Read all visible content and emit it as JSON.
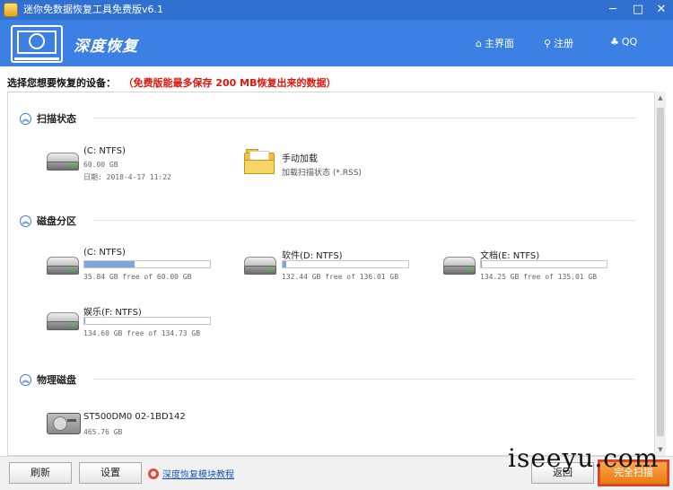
{
  "window": {
    "title": "迷你免数据恢复工具免费版v6.1",
    "min_label": "─",
    "max_label": "□",
    "close_label": "✕"
  },
  "header": {
    "brand": "深度恢复",
    "nav": [
      {
        "icon": "⌂",
        "label": "主界面"
      },
      {
        "icon": "⚲",
        "label": "注册"
      },
      {
        "icon": "♣",
        "label": "QQ"
      }
    ]
  },
  "prompt": {
    "label": "选择您想要恢复的设备：",
    "warning": "（免费版能最多保存 200 MB恢复出来的数据）"
  },
  "sections": {
    "scan_state": {
      "title": "扫描状态",
      "toggle": "︽",
      "items": [
        {
          "name": "(C: NTFS)",
          "size": "60.00 GB",
          "date": "日期: 2018-4-17 11:22"
        },
        {
          "name": "手动加载",
          "desc": "加载扫描状态 (*.RSS)"
        }
      ]
    },
    "partitions": {
      "title": "磁盘分区",
      "toggle": "︽",
      "items": [
        {
          "name": "(C: NTFS)",
          "usage": "35.84 GB free of 60.00 GB",
          "used_fraction": 0.4
        },
        {
          "name": "软件(D: NTFS)",
          "usage": "132.44 GB free of 136.01 GB",
          "used_fraction": 0.03
        },
        {
          "name": "文档(E: NTFS)",
          "usage": "134.25 GB free of 135.01 GB",
          "used_fraction": 0.01
        },
        {
          "name": "娱乐(F: NTFS)",
          "usage": "134.60 GB free of 134.73 GB",
          "used_fraction": 0.005
        }
      ]
    },
    "physical": {
      "title": "物理磁盘",
      "toggle": "︽",
      "items": [
        {
          "name": "ST500DM0 02-1BD142",
          "size": "465.76 GB"
        }
      ]
    }
  },
  "bottom": {
    "refresh": "刷新",
    "settings": "设置",
    "help": "深度恢复模块教程",
    "back": "返回",
    "scan": "完全扫描"
  },
  "watermark": "iseeyu.com",
  "scrollbar": {
    "up": "▲",
    "down": "▼"
  }
}
